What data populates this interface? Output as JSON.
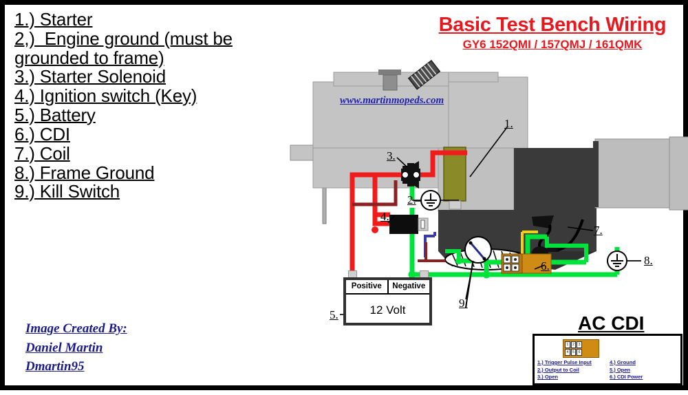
{
  "title": {
    "main": "Basic Test Bench Wiring",
    "sub": "GY6  152QMI / 157QMJ / 161QMK"
  },
  "watermark": "www.martinmopeds.com",
  "legend": {
    "items": [
      "1.) Starter",
      "2,)  Engine ground (must be",
      "grounded to frame)",
      "3.) Starter Solenoid",
      "4.) Ignition switch (Key)",
      "5.) Battery",
      "6.) CDI",
      "7.) Coil",
      "8.) Frame Ground",
      "9.) Kill Switch"
    ]
  },
  "credits": {
    "line1": "Image Created By:",
    "line2": "Daniel Martin",
    "line3": "Dmartin95"
  },
  "battery": {
    "positive_label": "Positive",
    "negative_label": "Negative",
    "voltage": "12 Volt"
  },
  "ac_cdi": {
    "heading": "AC CDI",
    "pins": [
      "1",
      "2",
      "3",
      "4",
      "5",
      "6"
    ],
    "left_column": [
      "1.) Trigger Pulse Input",
      "2.) Output to Coil",
      "3.) Open"
    ],
    "right_column": [
      "4.) Ground",
      "5.) Open",
      "6.) CDI Power"
    ]
  },
  "callouts": {
    "starter": "1.",
    "engine_ground": "2.",
    "solenoid": "3.",
    "ignition_switch": "4.",
    "battery": "5.",
    "cdi": "6.",
    "coil": "7.",
    "frame_ground": "8.",
    "kill_switch": "9."
  },
  "colors": {
    "title_red": "#e8191e",
    "credit_blue": "#1a1a8c",
    "wire_red": "#f01c1c",
    "wire_green": "#00e23c",
    "wire_blue": "#3a3aa8",
    "wire_darkred": "#8b2020",
    "wire_yellow": "#f5d000",
    "wire_black": "#000000",
    "cdi_body": "#cf8c14",
    "starter_body": "#8a8a28",
    "engine_light": "#c4c4c4",
    "engine_dark": "#3a3a3a"
  }
}
